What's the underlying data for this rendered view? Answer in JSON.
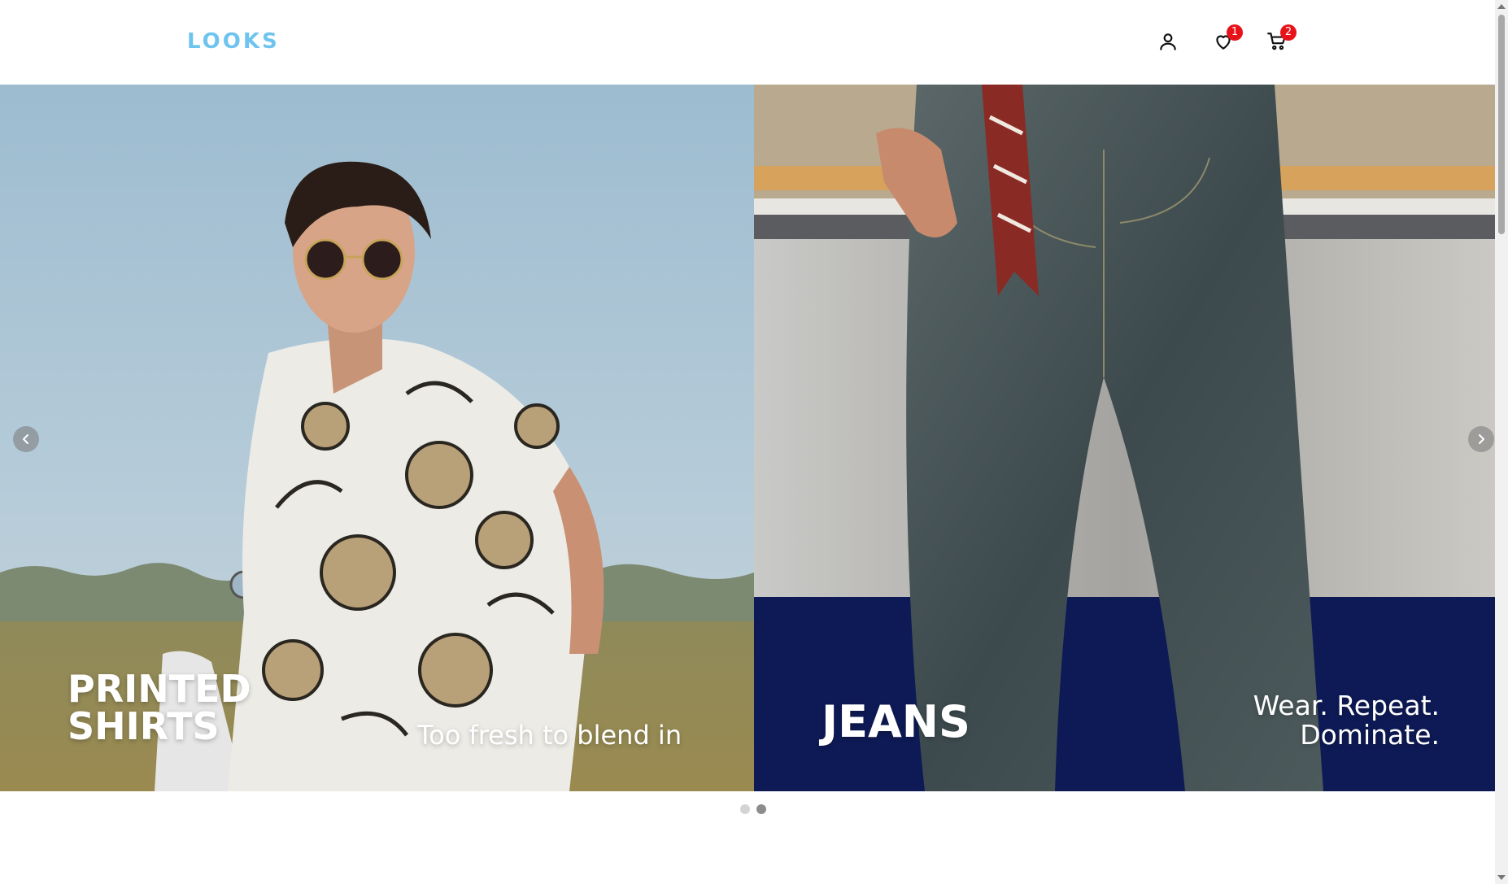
{
  "header": {
    "logo": "LOOKS",
    "wishlist_count": "1",
    "cart_count": "2",
    "icons": [
      "user-icon",
      "heart-icon",
      "cart-icon"
    ]
  },
  "carousel": {
    "slides": [
      {
        "title": "PRINTED\nSHIRTS",
        "subtitle": "Too fresh to blend in"
      },
      {
        "title": "JEANS",
        "subtitle": "Wear. Repeat.\nDominate."
      }
    ],
    "active_dot": 2,
    "dot_count": 2
  },
  "colors": {
    "logo": "#6ec4ee",
    "badge": "#e8131a",
    "dot_inactive": "#d4d4d4",
    "dot_active": "#8c8c8c"
  }
}
